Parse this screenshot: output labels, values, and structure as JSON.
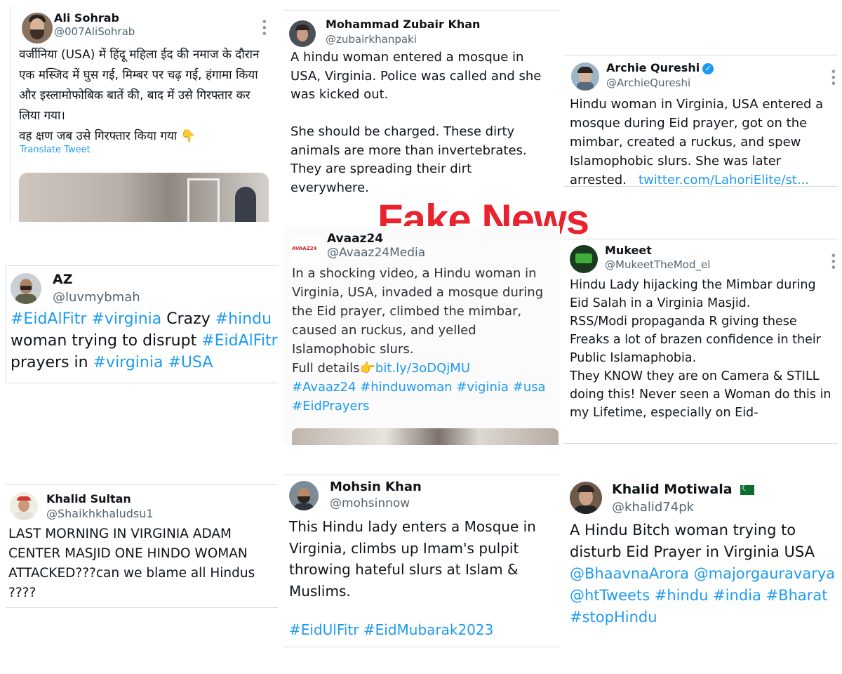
{
  "headline": "Fake News",
  "tweets": [
    {
      "name": "Ali Sohrab",
      "handle": "@007AliSohrab",
      "text": "वर्जीनिया (USA) में हिंदू महिला ईद की नमाज के दौरान एक मस्जिद में घुस गई, मिम्बर पर चढ़ गई, हंगामा किया और इस्लामोफोबिक बातें की, बाद में उसे गिरफ्तार कर लिया गया।\nवह क्षण जब उसे गिरफ्तार किया गया 👇",
      "translate": "Translate Tweet"
    },
    {
      "name": "Mohammad Zubair Khan",
      "handle": "@zubairkhanpaki",
      "text": "A hindu woman entered a mosque in USA, Virginia. Police was called and she was kicked out.\n\nShe should be charged. These dirty animals are more than invertebrates. They are spreading their dirt everywhere."
    },
    {
      "name": "Archie Qureshi",
      "handle": "@ArchieQureshi",
      "text": "Hindu woman in Virginia, USA entered a mosque during Eid prayer, got on the mimbar, created a ruckus, and spew Islamophobic slurs. She was later arrested.",
      "link": "twitter.com/LahoriElite/st..."
    },
    {
      "name": "AZ",
      "handle": "@luvmybmah",
      "tag1": "#EidAlFitr",
      "tag2": "#virginia",
      "t1": "Crazy",
      "tag3": "#hindu",
      "t2": "woman trying to disrupt",
      "tag4": "#EidAlFitr",
      "t3": "prayers in",
      "tag5": "#virginia",
      "tag6": "#USA"
    },
    {
      "name": "Avaaz24",
      "handle": "@Avaaz24Media",
      "logo": "AVAAZ24",
      "text": "In a shocking video, a Hindu woman in Virginia, USA, invaded a mosque during the Eid prayer, climbed the mimbar, caused an ruckus, and yelled Islamophobic slurs.",
      "details": "Full details👉",
      "link": "bit.ly/3oDQjMU",
      "tags": "#Avaaz24 #hinduwoman #viginia #usa #EidPrayers"
    },
    {
      "name": "Mukeet",
      "handle": "@MukeetTheMod_el",
      "text": "Hindu Lady hijacking the Mimbar during Eid Salah in a Virginia Masjid.\nRSS/Modi propaganda R giving these Freaks a lot of brazen confidence in their Public Islamaphobia.\nThey KNOW they are on Camera & STILL doing this! Never seen a Woman do this in my Lifetime, especially on Eid-"
    },
    {
      "name": "Khalid Sultan",
      "handle": "@Shaikhkhaludsu1",
      "text": "LAST MORNING IN VIRGINIA ADAM CENTER MASJID ONE HINDO WOMAN ATTACKED???can we blame all Hindus ????"
    },
    {
      "name": "Mohsin Khan",
      "handle": "@mohsinnow",
      "text": "This Hindu lady enters a Mosque in Virginia, climbs up Imam's pulpit throwing hateful slurs at Islam & Muslims.",
      "tags": "#EidUlFitr #EidMubarak2023"
    },
    {
      "name": "Khalid Motiwala",
      "handle": "@khalid74pk",
      "text": "A Hindu Bitch woman trying to disturb Eid Prayer in Virginia USA",
      "tags": "@BhaavnaArora @majorgauravarya @htTweets #hindu #india #Bharat #stopHindu"
    }
  ]
}
